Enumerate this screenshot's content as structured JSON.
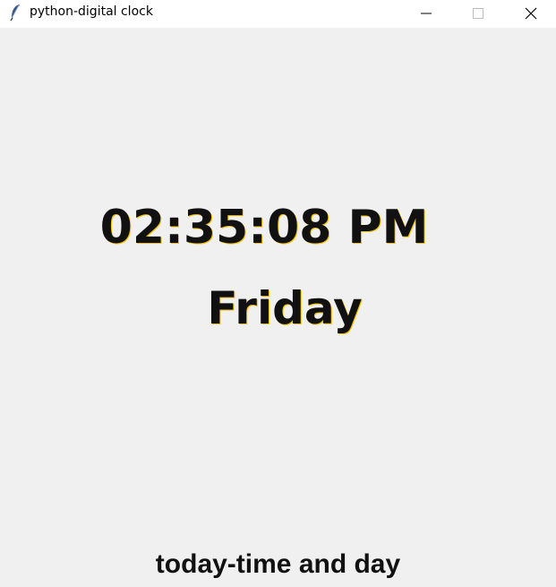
{
  "window": {
    "title": "python-digital clock",
    "icon": "feather-icon",
    "controls": {
      "minimize": "minimize-icon",
      "maximize": "maximize-icon",
      "close": "close-icon"
    }
  },
  "clock": {
    "time": "02:35:08 PM",
    "day": "Friday"
  },
  "footer": {
    "caption": "today-time and day"
  },
  "colors": {
    "titlebar": "#ffffff",
    "background": "#f0f0f0",
    "text": "#111111",
    "text_fringe": "#f2c200"
  }
}
